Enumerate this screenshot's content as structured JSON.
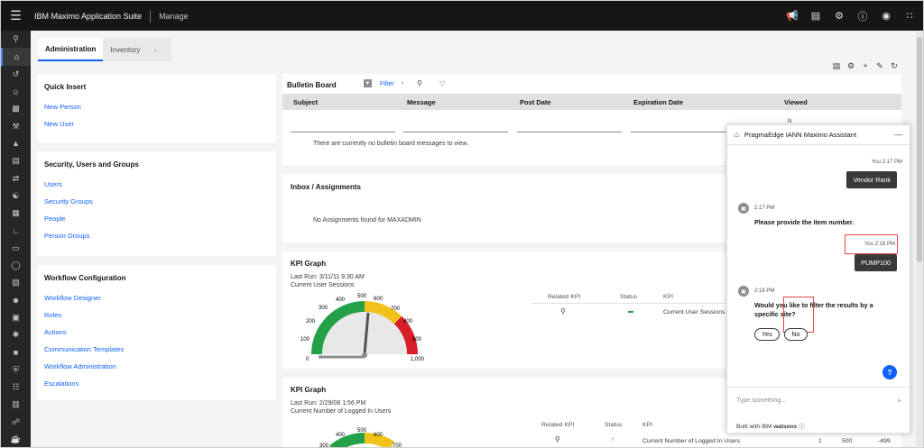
{
  "header": {
    "brand": "IBM Maximo Application Suite",
    "app": "Manage"
  },
  "tabs": [
    {
      "label": "Administration"
    },
    {
      "label": "Inventory"
    }
  ],
  "quick_insert": {
    "title": "Quick Insert",
    "items": [
      "New Person",
      "New User"
    ]
  },
  "security": {
    "title": "Security, Users and Groups",
    "items": [
      "Users",
      "Security Groups",
      "People",
      "Person Groups"
    ]
  },
  "workflow": {
    "title": "Workflow Configuration",
    "items": [
      "Workflow Designer",
      "Roles",
      "Actions",
      "Communication Templates",
      "Workflow Administration",
      "Escalations"
    ]
  },
  "bulletin": {
    "title": "Bulletin Board",
    "filter_label": "Filter",
    "columns": [
      "Subject",
      "Message",
      "Post Date",
      "Expiration Date",
      "Viewed"
    ],
    "viewed_filter": "N",
    "empty": "There are currently no bulletin board messages to view."
  },
  "inbox": {
    "title": "Inbox / Assignments",
    "empty": "No Assignments found for MAXADMIN"
  },
  "kpi1": {
    "title": "KPI Graph",
    "last_run": "Last Run: 3/11/11 9:30 AM",
    "subtitle": "Current User Sessions",
    "cols": [
      "Related KPI",
      "Status",
      "KPI"
    ],
    "row_kpi": "Current User Sessions",
    "status_color": "#24a148",
    "gauge_labels": [
      "0",
      "100",
      "200",
      "300",
      "400",
      "500",
      "600",
      "700",
      "800",
      "900",
      "1,000"
    ]
  },
  "kpi2": {
    "title": "KPI Graph",
    "last_run": "Last Run: 2/29/08 1:56 PM",
    "subtitle": "Current Number of Logged In Users",
    "cols": [
      "Related KPI",
      "Status",
      "KPI"
    ],
    "row_kpi": "Current Number of Logged In Users",
    "row_values": [
      "1",
      "500",
      "-499"
    ],
    "status_color": "#24a148",
    "gauge_labels": [
      "300",
      "400",
      "500",
      "600",
      "700"
    ]
  },
  "chat": {
    "title": "PragmaEdge IANN Maximo Assistant",
    "messages": [
      {
        "who": "user",
        "time": "You 2:17 PM",
        "text": "Vendor Rank"
      },
      {
        "who": "bot",
        "time": "2:17 PM",
        "text": "Please provide the item number."
      },
      {
        "who": "user",
        "time": "You 2:18 PM",
        "text": "PUMP100"
      },
      {
        "who": "bot",
        "time": "2:18 PM",
        "text_lines": [
          "Would you like to filter the results by a",
          "specific site?"
        ]
      }
    ],
    "buttons": [
      "Yes",
      "No"
    ],
    "input_placeholder": "Type something...",
    "footer_text": "Built with IBM",
    "footer_brand": "watsonx",
    "help": "?"
  },
  "colors": {
    "accent": "#0f62fe",
    "header_bg": "#161616",
    "rail_bg": "#262626",
    "gauge_green": "#24a148",
    "gauge_yellow": "#f1c21b",
    "gauge_red": "#da1e28",
    "highlight": "#e4484c"
  }
}
